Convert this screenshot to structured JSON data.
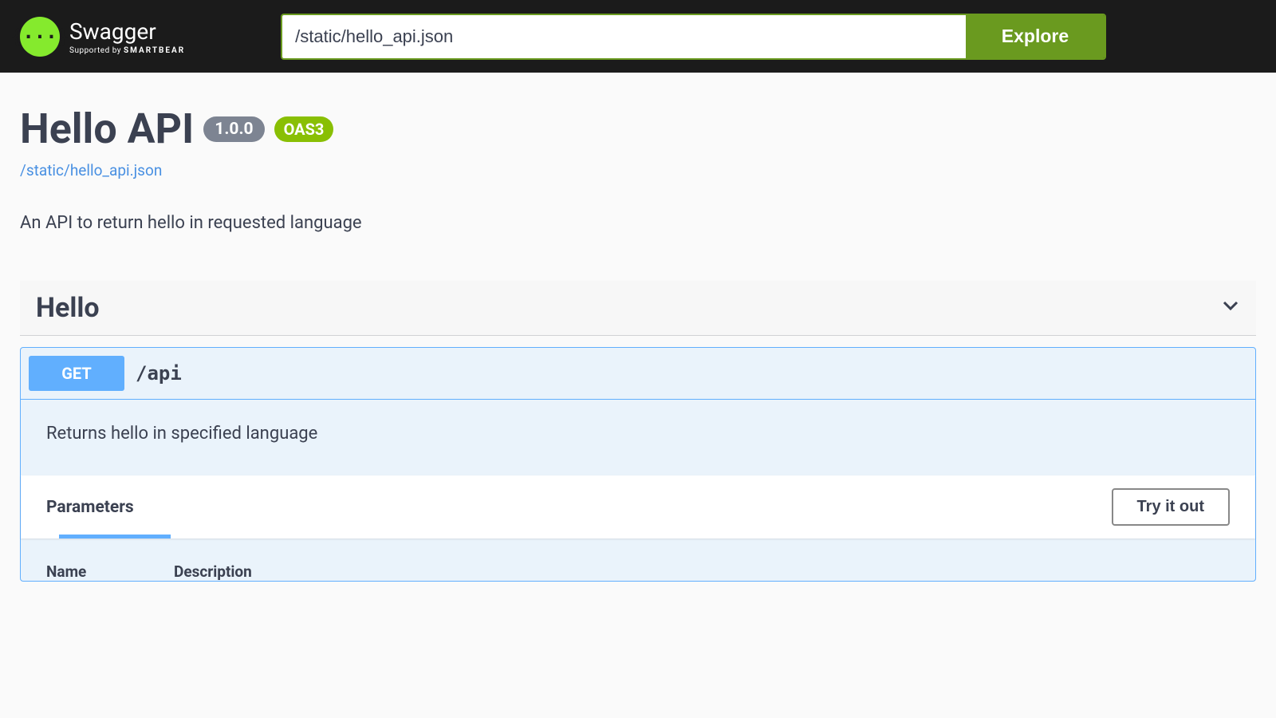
{
  "topbar": {
    "logo_main": "Swagger",
    "logo_sub_prefix": "Supported by ",
    "logo_sub_bold": "SMARTBEAR",
    "logo_glyph": "{···}",
    "url_value": "/static/hello_api.json",
    "explore_label": "Explore"
  },
  "info": {
    "title": "Hello API",
    "version": "1.0.0",
    "oas_badge": "OAS3",
    "spec_url": "/static/hello_api.json",
    "description": "An API to return hello in requested language"
  },
  "tag": {
    "name": "Hello"
  },
  "operation": {
    "method": "GET",
    "path": "/api",
    "summary": "Returns hello in specified language",
    "parameters_label": "Parameters",
    "try_label": "Try it out",
    "columns": {
      "name": "Name",
      "description": "Description"
    }
  }
}
